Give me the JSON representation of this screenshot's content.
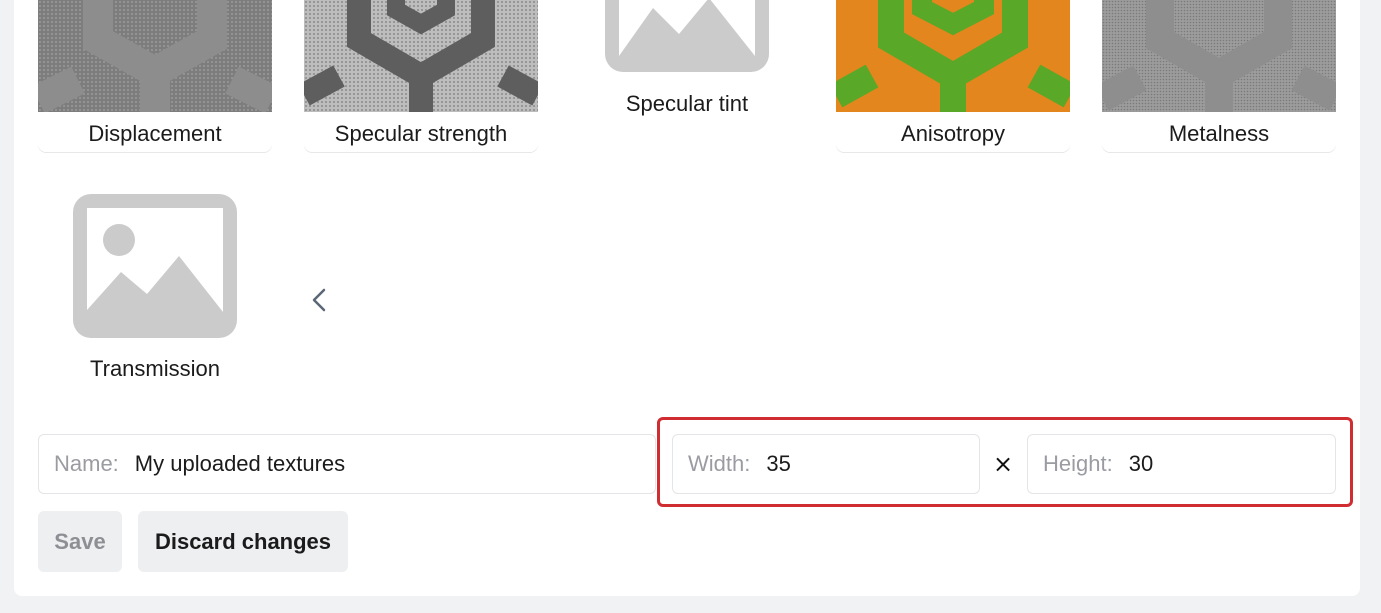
{
  "textures": [
    {
      "label": "Displacement"
    },
    {
      "label": "Specular strength"
    },
    {
      "label": "Specular tint"
    },
    {
      "label": "Anisotropy"
    },
    {
      "label": "Metalness"
    },
    {
      "label": "Transmission"
    }
  ],
  "icons": {
    "placeholder": "image-placeholder-icon",
    "back": "chevron-left-icon"
  },
  "form": {
    "name_label": "Name:",
    "name_value": "My uploaded textures",
    "width_label": "Width:",
    "width_value": "35",
    "times_symbol": "×",
    "height_label": "Height:",
    "height_value": "30"
  },
  "actions": {
    "save_label": "Save",
    "discard_label": "Discard changes"
  },
  "colors": {
    "highlight": "#cf2d32",
    "anisotropy_green": "#5aa827",
    "anisotropy_orange": "#e2861d"
  }
}
